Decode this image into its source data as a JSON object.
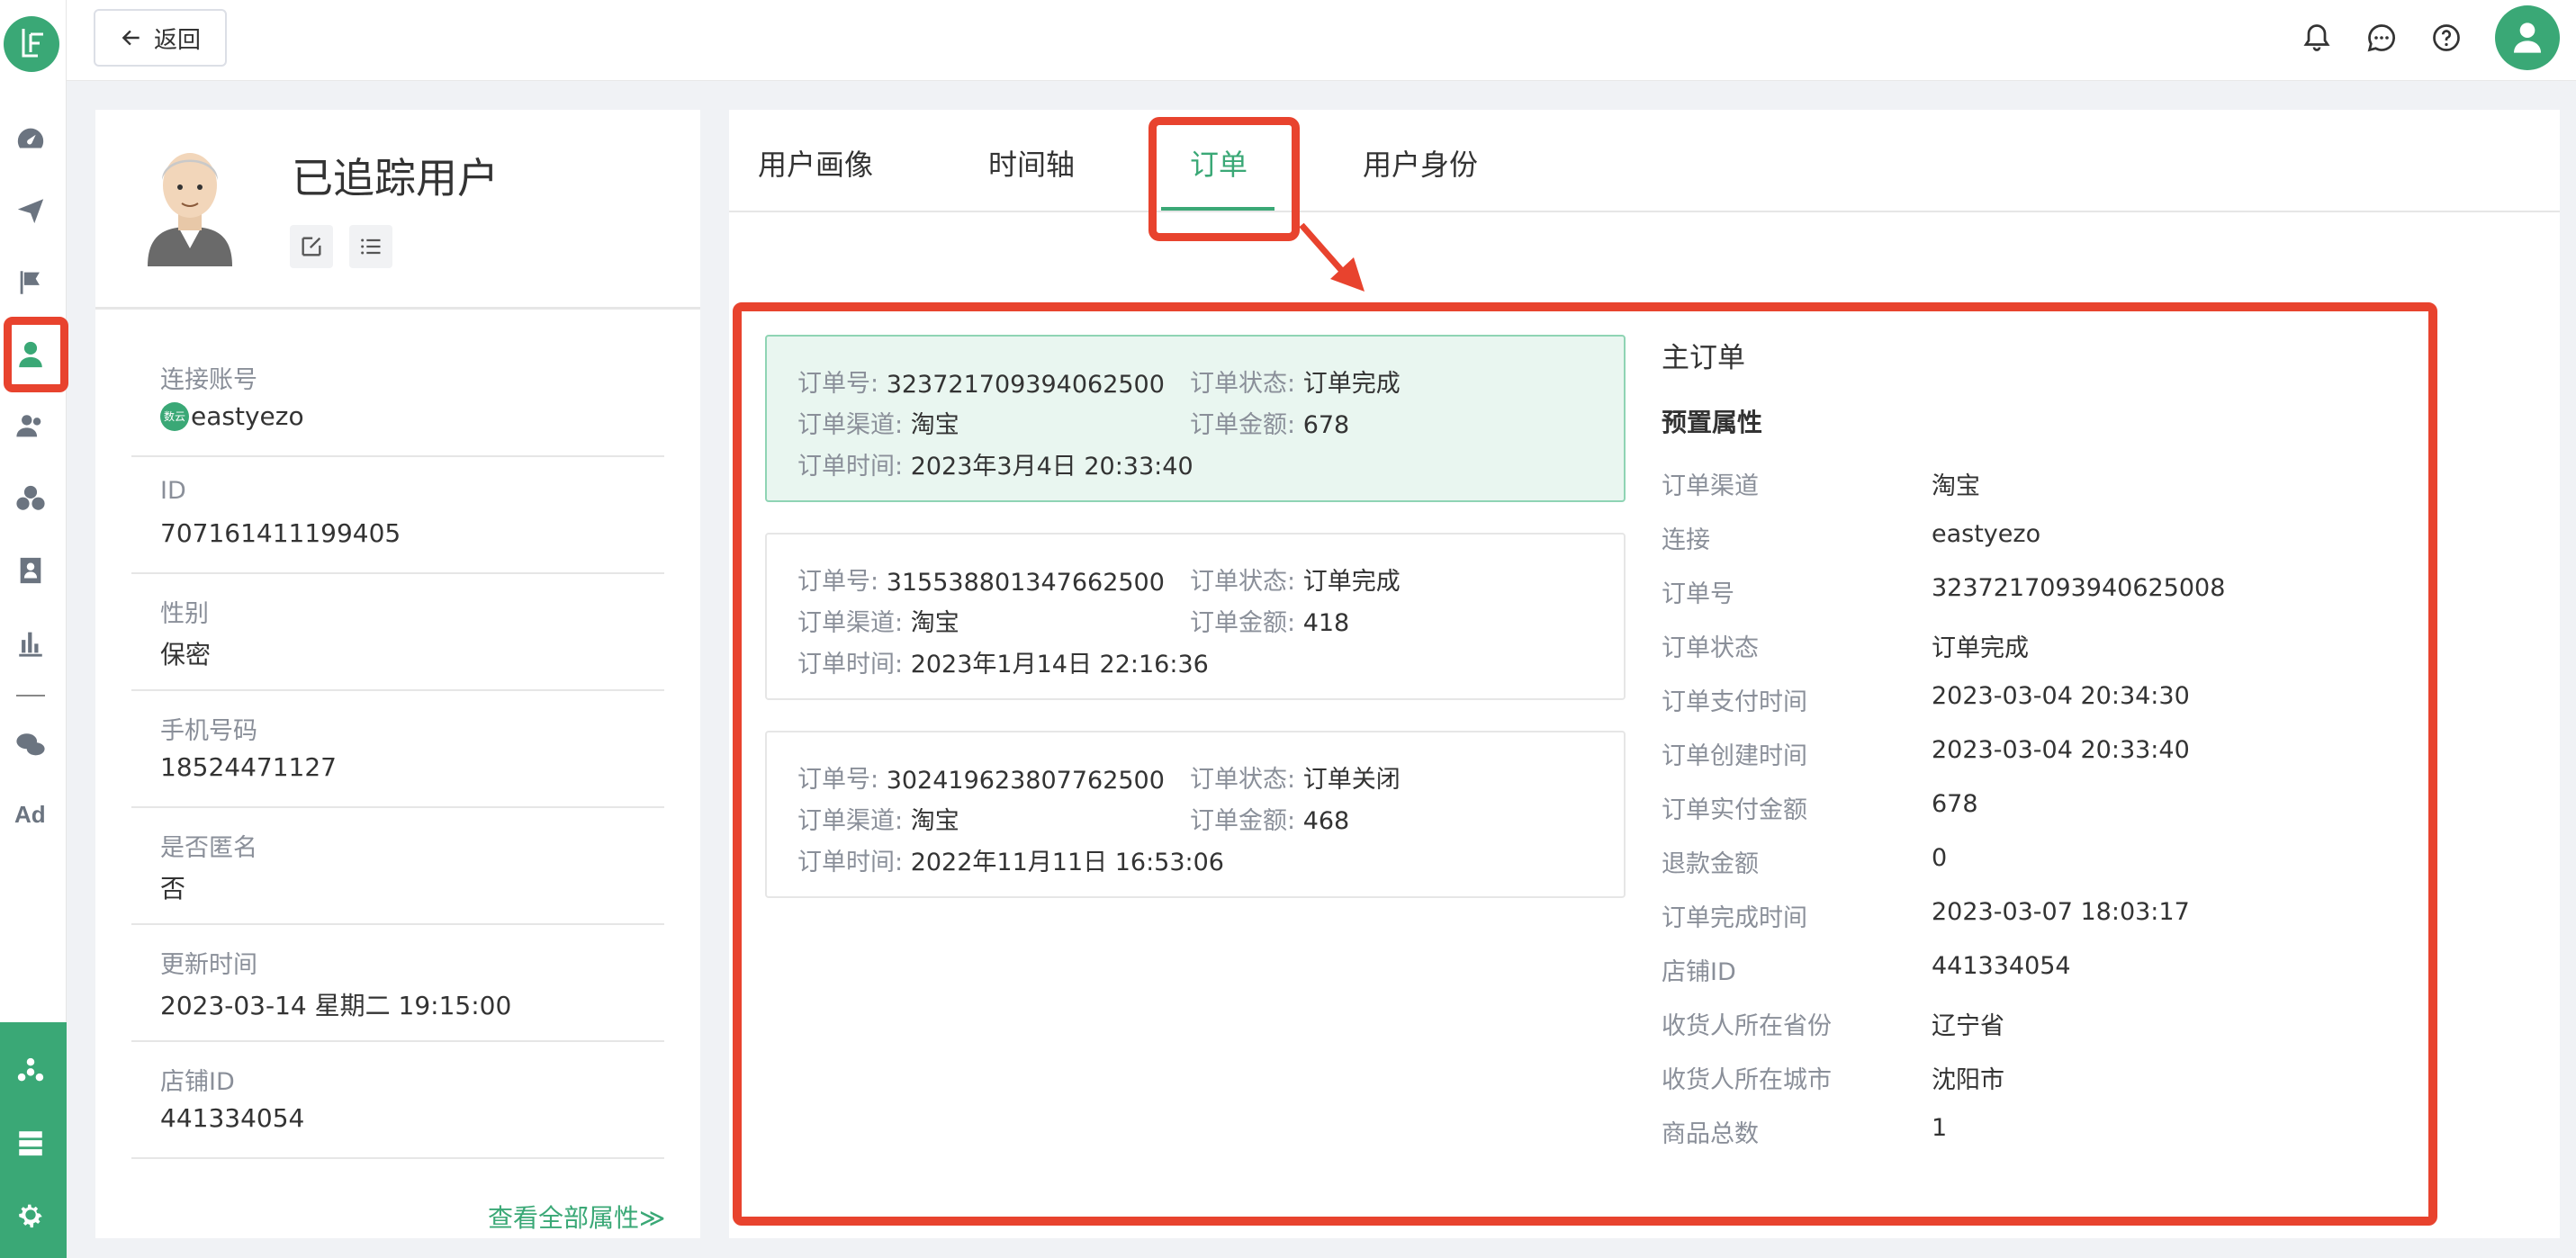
{
  "header": {
    "back_label": "返回"
  },
  "profile": {
    "title": "已追踪用户",
    "attributes": [
      {
        "key": "连接账号",
        "value": "eastyezo",
        "badge": "数云"
      },
      {
        "key": "ID",
        "value": "707161411199405"
      },
      {
        "key": "性别",
        "value": "保密"
      },
      {
        "key": "手机号码",
        "value": "18524471127"
      },
      {
        "key": "是否匿名",
        "value": "否"
      },
      {
        "key": "更新时间",
        "value": "2023-03-14 星期二 19:15:00"
      },
      {
        "key": "店铺ID",
        "value": "441334054"
      }
    ],
    "view_all_label": "查看全部属性≫"
  },
  "tabs": [
    {
      "label": "用户画像"
    },
    {
      "label": "时间轴"
    },
    {
      "label": "订单"
    },
    {
      "label": "用户身份"
    }
  ],
  "orders": {
    "labels": {
      "order_no": "订单号:",
      "status": "订单状态:",
      "channel": "订单渠道:",
      "amount": "订单金额:",
      "time": "订单时间:"
    },
    "items": [
      {
        "order_no": "323721709394062500",
        "status": "订单完成",
        "channel": "淘宝",
        "amount": "678",
        "time": "2023年3月4日 20:33:40"
      },
      {
        "order_no": "315538801347662500",
        "status": "订单完成",
        "channel": "淘宝",
        "amount": "418",
        "time": "2023年1月14日 22:16:36"
      },
      {
        "order_no": "302419623807762500",
        "status": "订单关闭",
        "channel": "淘宝",
        "amount": "468",
        "time": "2022年11月11日 16:53:06"
      }
    ]
  },
  "detail": {
    "title": "主订单",
    "section": "预置属性",
    "fields": [
      {
        "key": "订单渠道",
        "value": "淘宝"
      },
      {
        "key": "连接",
        "value": "eastyezo"
      },
      {
        "key": "订单号",
        "value": "323721709394062500​8"
      },
      {
        "key": "订单状态",
        "value": "订单完成"
      },
      {
        "key": "订单支付时间",
        "value": "2023-03-04 20:34:30"
      },
      {
        "key": "订单创建时间",
        "value": "2023-03-04 20:33:40"
      },
      {
        "key": "订单实付金额",
        "value": "678"
      },
      {
        "key": "退款金额",
        "value": "0"
      },
      {
        "key": "订单完成时间",
        "value": "2023-03-07 18:03:17"
      },
      {
        "key": "店铺ID",
        "value": "441334054"
      },
      {
        "key": "收货人所在省份",
        "value": "辽宁省"
      },
      {
        "key": "收货人所在城市",
        "value": "沈阳市"
      },
      {
        "key": "商品总数",
        "value": "1"
      }
    ]
  },
  "colors": {
    "accent": "#3aa876",
    "highlight": "#e8432e"
  }
}
